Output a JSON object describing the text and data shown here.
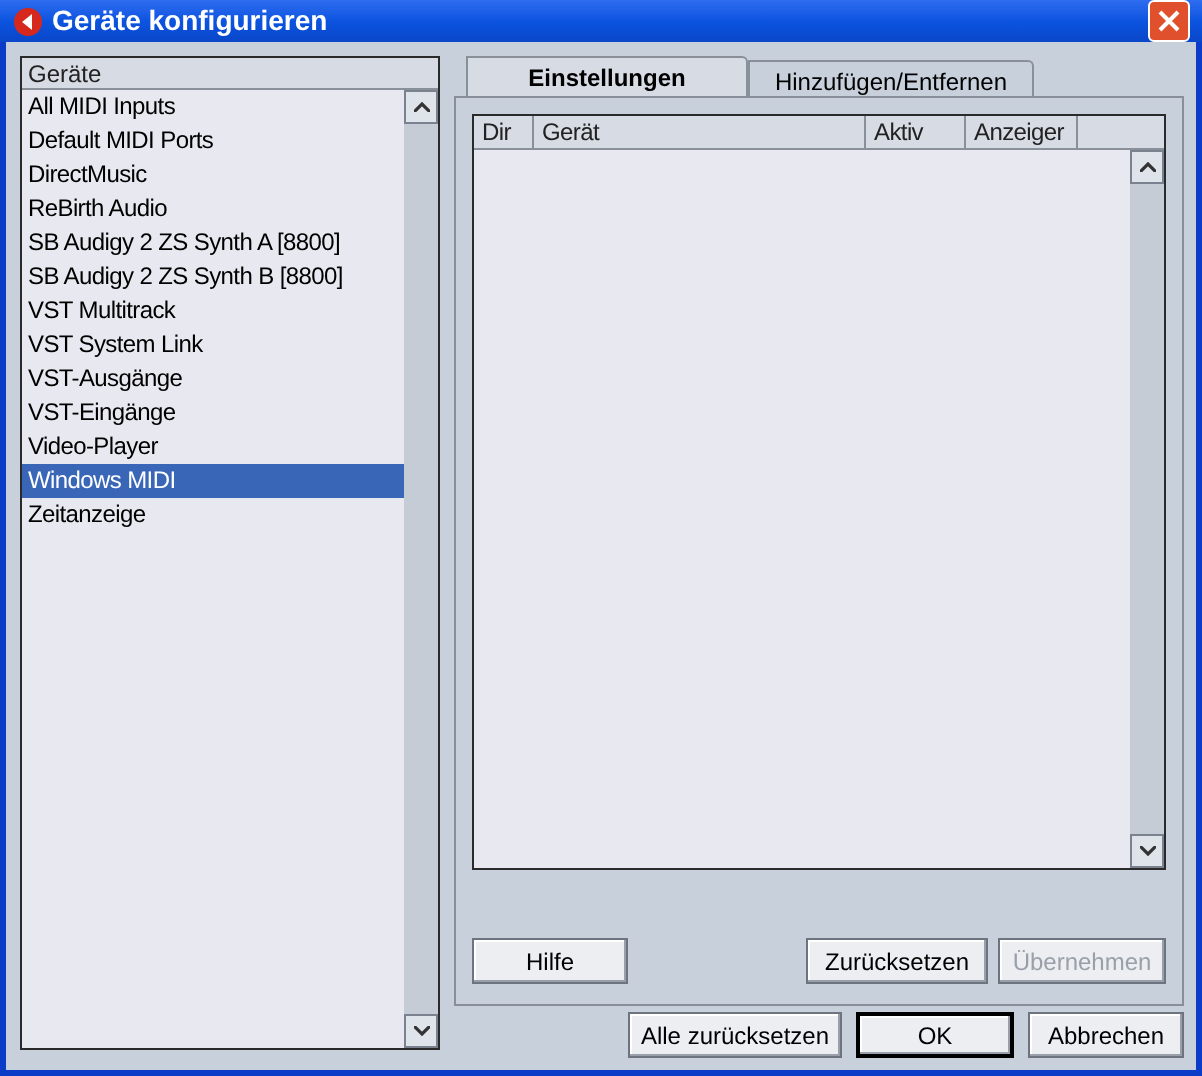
{
  "window": {
    "title": "Geräte konfigurieren"
  },
  "device_list": {
    "header": "Geräte",
    "items": [
      {
        "label": "All MIDI Inputs",
        "selected": false
      },
      {
        "label": "Default MIDI Ports",
        "selected": false
      },
      {
        "label": "DirectMusic",
        "selected": false
      },
      {
        "label": "ReBirth Audio",
        "selected": false
      },
      {
        "label": "SB Audigy 2 ZS Synth A [8800]",
        "selected": false
      },
      {
        "label": "SB Audigy 2 ZS Synth B [8800]",
        "selected": false
      },
      {
        "label": "VST Multitrack",
        "selected": false
      },
      {
        "label": "VST System Link",
        "selected": false
      },
      {
        "label": "VST-Ausgänge",
        "selected": false
      },
      {
        "label": "VST-Eingänge",
        "selected": false
      },
      {
        "label": "Video-Player",
        "selected": false
      },
      {
        "label": "Windows MIDI",
        "selected": true
      },
      {
        "label": "Zeitanzeige",
        "selected": false
      }
    ]
  },
  "tabs": [
    {
      "label": "Einstellungen",
      "selected": true
    },
    {
      "label": "Hinzufügen/Entfernen",
      "selected": false
    }
  ],
  "table": {
    "columns": [
      "Dir",
      "Gerät",
      "Aktiv",
      "Anzeiger"
    ]
  },
  "panel_buttons": [
    {
      "label": "Hilfe",
      "disabled": false
    },
    {
      "label": "Zurücksetzen",
      "disabled": false
    },
    {
      "label": "Übernehmen",
      "disabled": true
    }
  ],
  "dialog_buttons": [
    {
      "label": "Alle zurücksetzen",
      "default": false
    },
    {
      "label": "OK",
      "default": true
    },
    {
      "label": "Abbrechen",
      "default": false
    }
  ]
}
